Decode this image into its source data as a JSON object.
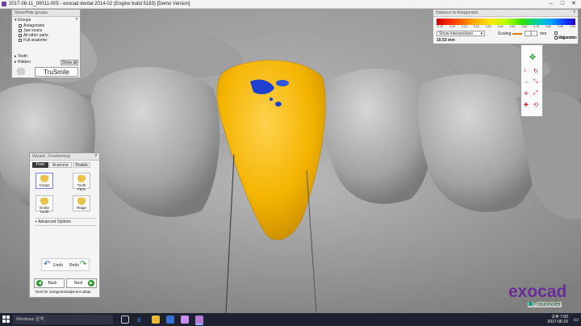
{
  "window": {
    "title": "2017-06-11_00011-005 - exocad dental 2014-02 (Engine build 5183) [Demo Version]"
  },
  "show_hide": {
    "title": "Show/Hide groups",
    "groups_label": "Groups",
    "help": "?",
    "items": [
      {
        "label": "Antagonists",
        "checked": true
      },
      {
        "label": "Jaw scans",
        "checked": true
      },
      {
        "label": "All other parts",
        "checked": true
      },
      {
        "label": "Full anatomic",
        "checked": true
      }
    ],
    "tooth_label": "Tooth",
    "hidden_label": "Hidden",
    "show_all_label": "Show all",
    "trusmile_label": "TruSmile"
  },
  "distance": {
    "title": "Distance to Antagonists",
    "help": "?",
    "scale_labels": [
      "-0.10",
      "0.00",
      "0.10",
      "0.20",
      "0.30",
      "0.40",
      "0.50",
      "0.60",
      "0.70",
      "0.80",
      "0.90",
      "1.00"
    ],
    "dropdown_value": "Show intersections",
    "scaling_label": "Scaling",
    "scaling_value": "1",
    "scaling_unit": "mm",
    "distance_value": "10.53 mm",
    "options": [
      {
        "label": "Antagonists",
        "checked": true
      },
      {
        "label": "Adjacents",
        "checked": false
      }
    ]
  },
  "wizard": {
    "title": "Wizard - Freeforming",
    "help": "?",
    "tabs": [
      "Free",
      "Anatomic",
      "Positio"
    ],
    "tools": [
      {
        "label": "Cusps",
        "icon": "cusp-icon"
      },
      {
        "label": "Tooth Parts",
        "icon": "tooth-parts-icon"
      },
      {
        "label": "Entire Tooth",
        "icon": "entire-tooth-icon"
      },
      {
        "label": "Ridge",
        "icon": "ridge-icon"
      }
    ],
    "advanced_label": "+ Advanced Options",
    "undo_label": "Undo",
    "redo_label": "Redo",
    "back_label": "Back",
    "next_label": "Next",
    "hint": "Next for antagonist/adjacent adapt"
  },
  "brand": {
    "name": "exocad",
    "sub": "Fraunhofer"
  },
  "taskbar": {
    "search_placeholder": "Windows 검색",
    "time": "오후 7:00",
    "date": "2017-06-15"
  },
  "colors": {
    "crown": "#f4b400",
    "contact": "#1e3fd0",
    "brand_purple": "#6a2b97",
    "taskbar": "#1c2230"
  }
}
